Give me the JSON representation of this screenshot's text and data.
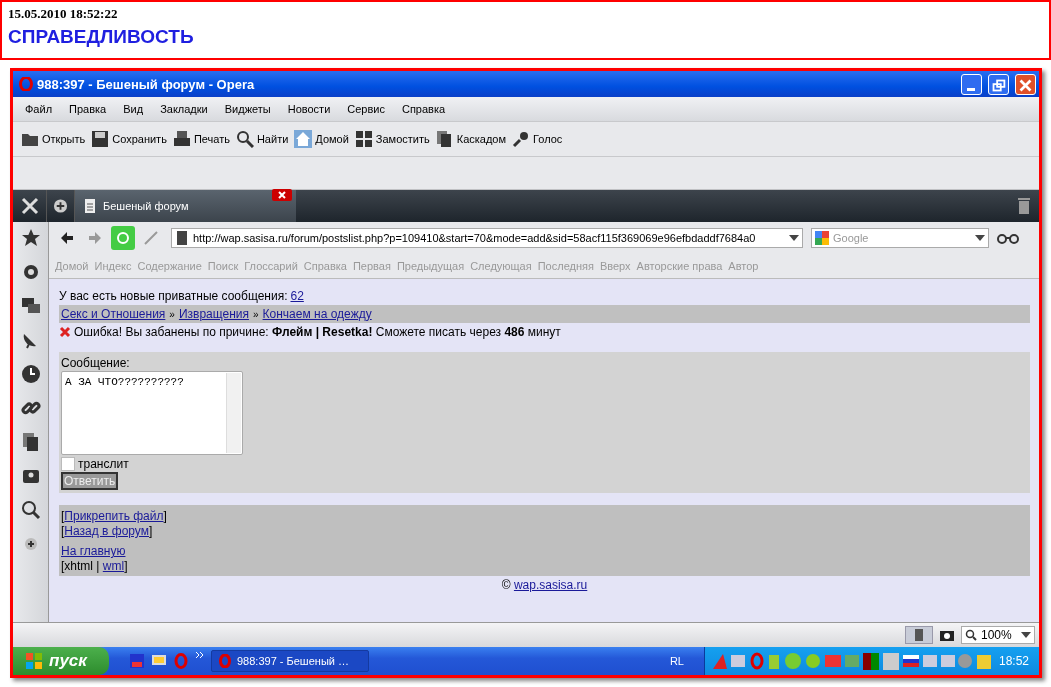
{
  "header": {
    "timestamp": "15.05.2010 18:52:22",
    "title": "СПРАВЕДЛИВОСТЬ"
  },
  "window": {
    "title": "988:397 - Бешеный форум - Opera"
  },
  "menu": [
    "Файл",
    "Правка",
    "Вид",
    "Закладки",
    "Виджеты",
    "Новости",
    "Сервис",
    "Справка"
  ],
  "toolbar": [
    {
      "kind": "open",
      "label": "Открыть"
    },
    {
      "kind": "save",
      "label": "Сохранить"
    },
    {
      "kind": "print",
      "label": "Печать"
    },
    {
      "kind": "find",
      "label": "Найти"
    },
    {
      "kind": "home",
      "label": "Домой"
    },
    {
      "kind": "tile",
      "label": "Замостить"
    },
    {
      "kind": "cascade",
      "label": "Каскадом"
    },
    {
      "kind": "voice",
      "label": "Голос"
    }
  ],
  "tabs": [
    {
      "label": "Бешеный форум",
      "selected": true
    }
  ],
  "address": {
    "url": "http://wap.sasisa.ru/forum/postslist.php?p=109410&start=70&mode=add&sid=58acf115f369069e96efbdaddf7684a0"
  },
  "search": {
    "placeholder": "Google"
  },
  "nav_links": [
    "Домой",
    "Индекс",
    "Содержание",
    "Поиск",
    "Глоссарий",
    "Справка",
    "Первая",
    "Предыдущая",
    "Следующая",
    "Последняя",
    "Вверх",
    "Авторские права",
    "Автор"
  ],
  "page": {
    "private_text": "У вас есть новые приватные сообщения:",
    "private_count": "62",
    "breadcrumbs": [
      "Секс и Отношения",
      "Извращения",
      "Кончаем на одежду"
    ],
    "breadcrumb_separator": "»",
    "error": "Ошибка! Вы забанены по причине: **Флейм | Resetka!** Сможете писать через **486** минут",
    "form": {
      "label": "Сообщение:",
      "value": "А ЗА ЧТО??????????",
      "translit": {
        "label": "транслит",
        "checked": false
      },
      "submit": "Ответить"
    },
    "footer_links": [
      {
        "before": "[",
        "label": "Прикрепить файл",
        "after": "]"
      },
      {
        "before": "[",
        "label": "Назад в форум",
        "after": "]"
      },
      {
        "label": "На главную"
      },
      {
        "before": "[xhtml |",
        "label": "wml",
        "after": "]"
      }
    ],
    "copyright": "©",
    "copyright_link": "wap.sasisa.ru"
  },
  "status_bar": {
    "zoom": "100%"
  },
  "taskbar": {
    "start": "пуск",
    "task": "988:397 - Бешеный …",
    "language": "RL",
    "time": "18:52"
  }
}
